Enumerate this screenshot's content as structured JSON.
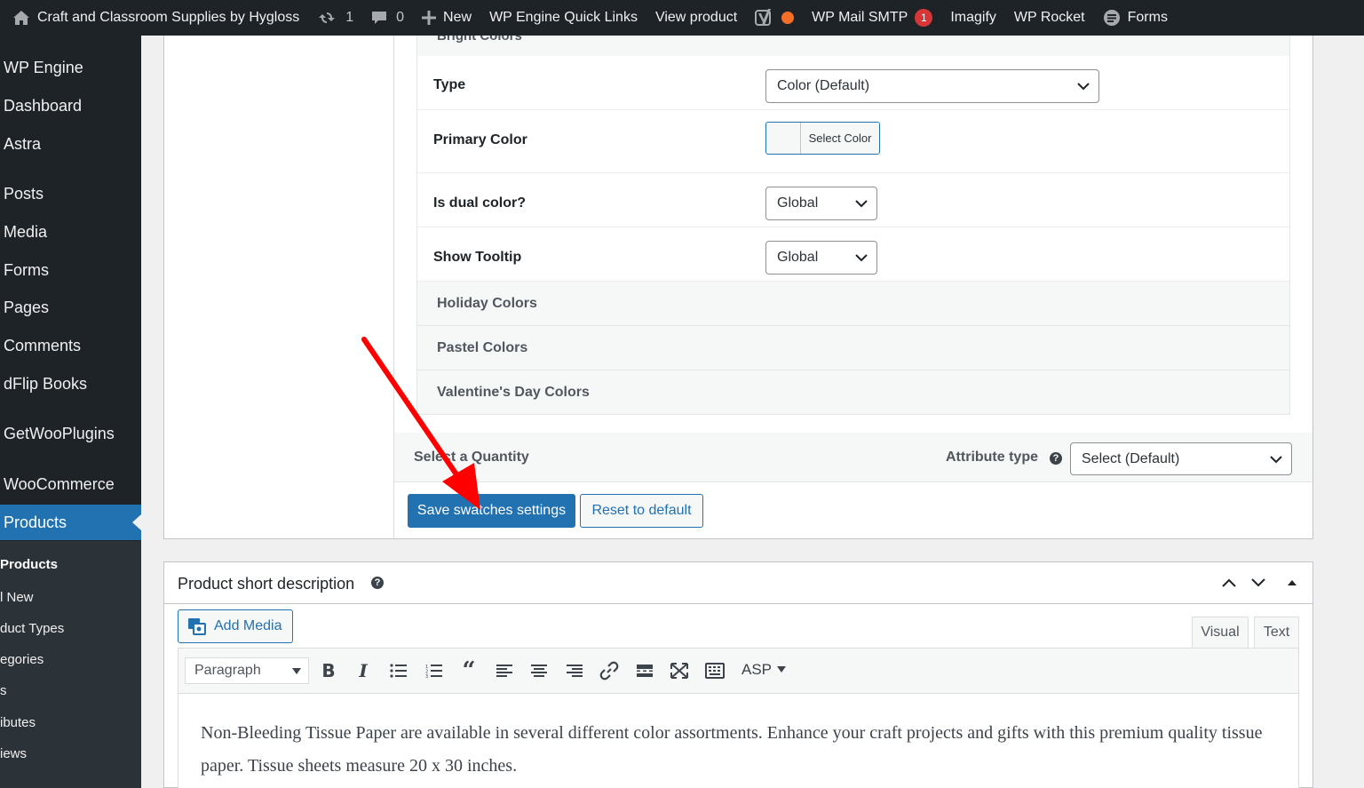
{
  "admin_bar": {
    "site_name": "Craft and Classroom Supplies by Hygloss",
    "updates_count": "1",
    "comments_count": "0",
    "new_label": "New",
    "quick_links": "WP Engine Quick Links",
    "view_product": "View product",
    "smtp_label": "WP Mail SMTP",
    "smtp_badge": "1",
    "imagify": "Imagify",
    "rocket": "WP Rocket",
    "forms": "Forms"
  },
  "sidebar": {
    "items": [
      "WP Engine",
      "Dashboard",
      "Astra",
      "Posts",
      "Media",
      "Forms",
      "Pages",
      "Comments",
      "dFlip Books",
      "GetWooPlugins",
      "WooCommerce",
      "Products"
    ],
    "current": "Products",
    "submenu": [
      "Products",
      "l New",
      "duct Types",
      "egories",
      "s",
      "ibutes",
      "iews"
    ]
  },
  "swatches": {
    "term_header_partial": "Bright Colors",
    "type_label": "Type",
    "type_value": "Color (Default)",
    "primary_color_label": "Primary Color",
    "select_color_button": "Select Color",
    "dual_color_label": "Is dual color?",
    "dual_color_value": "Global",
    "tooltip_label": "Show Tooltip",
    "tooltip_value": "Global",
    "groups": [
      "Holiday Colors",
      "Pastel Colors",
      "Valentine's Day Colors"
    ],
    "quantity_label": "Select a Quantity",
    "attribute_type_label": "Attribute type",
    "attribute_type_value": "Select (Default)",
    "save_button": "Save swatches settings",
    "reset_button": "Reset to default"
  },
  "short_description": {
    "title": "Product short description",
    "add_media": "Add Media",
    "tab_visual": "Visual",
    "tab_text": "Text",
    "format_value": "Paragraph",
    "asp_label": "ASP",
    "content": "Non-Bleeding Tissue Paper are available in several different color assortments. Enhance your craft projects and gifts with this premium quality tissue paper. Tissue sheets measure 20 x 30 inches."
  },
  "colors": {
    "admin_dark": "#1d2327",
    "primary": "#2271b1",
    "arrow": "#ff0000",
    "badge": "#d63638"
  }
}
